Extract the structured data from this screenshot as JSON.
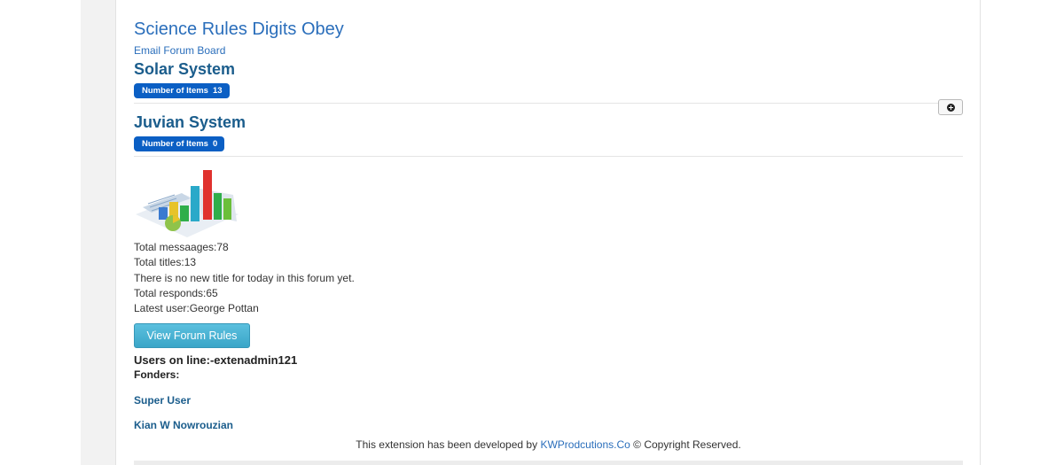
{
  "forum": {
    "title": "Science Rules Digits Obey",
    "board_link": "Email Forum Board"
  },
  "categories": [
    {
      "title": "Solar System",
      "badge_label": "Number of Items",
      "count": "13"
    },
    {
      "title": "Juvian System",
      "badge_label": "Number of Items",
      "count": "0"
    }
  ],
  "stats": {
    "messages": "Total messaages:78",
    "titles": "Total titles:13",
    "new_title": "There is no new title for today in this forum yet.",
    "responds": "Total responds:65",
    "latest_user": "Latest user:George Pottan"
  },
  "rules_button": "View Forum Rules",
  "online": {
    "users": "Users on line:-extenadmin121",
    "fonders_label": "Fonders:"
  },
  "fonders": [
    "Super User",
    "Kian W Nowrouzian"
  ],
  "footer": {
    "prefix": "This extension has been developed by ",
    "company": "KWProdcutions.Co",
    "suffix": " © Copyright Reserved."
  },
  "icons": {
    "add_button": "plus-circle-icon",
    "forum_image": "3d-bar-chart-illustration"
  },
  "colors": {
    "link": "#2a6ebb",
    "badge": "#0b5fc4",
    "button": "#5bc0de"
  }
}
